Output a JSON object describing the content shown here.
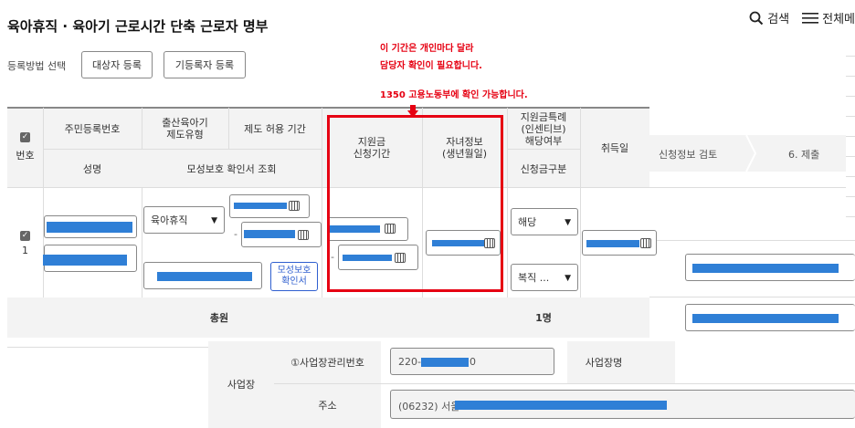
{
  "page": {
    "title": "육아휴직 · 육아기 근로시간 단축 근로자 명부"
  },
  "topnav": {
    "search_label": "검색",
    "menu_label": "전체메"
  },
  "registration": {
    "label": "등록방법 선택",
    "target_button": "대상자 등록",
    "existing_button": "기등록자 등록"
  },
  "notes": {
    "line1": "이 기간은 개인마다 달라",
    "line2": "담당자 확인이 필요합니다.",
    "line3": "1350 고용노동부에 확인 가능합니다."
  },
  "table": {
    "h_number": "번호",
    "h_rrn": "주민등록번호",
    "h_leave_type": "출산육아기\n제도유형",
    "h_allowed_period": "제도 허용 기간",
    "h_apply_period": "지원금\n신청기간",
    "h_child": "자녀정보\n(생년월일)",
    "h_special": "지원금특례\n(인센티브)\n해당여부",
    "h_acquire": "취득일",
    "h_name": "성명",
    "h_maternity": "모성보호 확인서 조회",
    "h_apply_type": "신청금구분",
    "row_no": "1",
    "leave_type_value": "육아휴직",
    "special_value": "해당",
    "apply_type_value": "복직 ...",
    "maternity_button": "모성보호\n확인서",
    "total_label": "총원",
    "total_value": "1명"
  },
  "steps": {
    "review": "신청정보 검토",
    "submit": "6. 제출"
  },
  "workplace": {
    "section_label": "사업장",
    "mgmt_no_label": "①사업장관리번호",
    "mgmt_no_prefix": "220-",
    "mgmt_no_suffix": "0",
    "name_label": "사업장명",
    "address_label": "주소",
    "address_prefix": "(06232) 서울"
  },
  "colors": {
    "accent_red": "#e60012",
    "mask_blue": "#2f7fd6",
    "header_gray": "#f3f3f3"
  }
}
